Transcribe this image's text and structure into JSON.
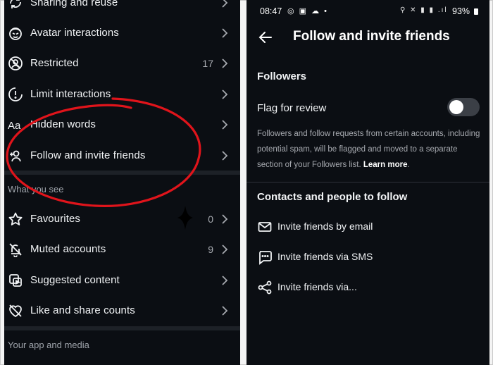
{
  "left_panel": {
    "rows": [
      {
        "label": "Sharing and reuse",
        "icon": "share-reuse-icon",
        "count": ""
      },
      {
        "label": "Avatar interactions",
        "icon": "avatar-icon",
        "count": ""
      },
      {
        "label": "Restricted",
        "icon": "restricted-icon",
        "count": "17"
      },
      {
        "label": "Limit interactions",
        "icon": "limit-icon",
        "count": ""
      },
      {
        "label": "Hidden words",
        "icon": "hidden-words-icon",
        "count": ""
      },
      {
        "label": "Follow and invite friends",
        "icon": "add-person-icon",
        "count": ""
      }
    ],
    "section_what_you_see": "What you see",
    "rows2": [
      {
        "label": "Favourites",
        "icon": "star-icon",
        "count": "0"
      },
      {
        "label": "Muted accounts",
        "icon": "bell-off-icon",
        "count": "9"
      },
      {
        "label": "Suggested content",
        "icon": "suggested-content-icon",
        "count": ""
      },
      {
        "label": "Like and share counts",
        "icon": "heart-off-icon",
        "count": ""
      }
    ],
    "section_your_app": "Your app and media"
  },
  "right_panel": {
    "status": {
      "time": "08:47",
      "battery": "93%"
    },
    "title": "Follow and invite friends",
    "followers_heading": "Followers",
    "flag_label": "Flag for review",
    "flag_enabled": false,
    "description": "Followers and follow requests from certain accounts, including potential spam, will be flagged and moved to a separate section of your Followers list.",
    "learn_more": "Learn more",
    "contacts_heading": "Contacts and people to follow",
    "invites": [
      {
        "label": "Invite friends by email",
        "icon": "mail-icon"
      },
      {
        "label": "Invite friends via SMS",
        "icon": "sms-icon"
      },
      {
        "label": "Invite friends via...",
        "icon": "share-icon"
      }
    ]
  },
  "colors": {
    "background": "#0b0e13",
    "annotation": "#e0141b",
    "toggle_off": "#3b3f46"
  }
}
